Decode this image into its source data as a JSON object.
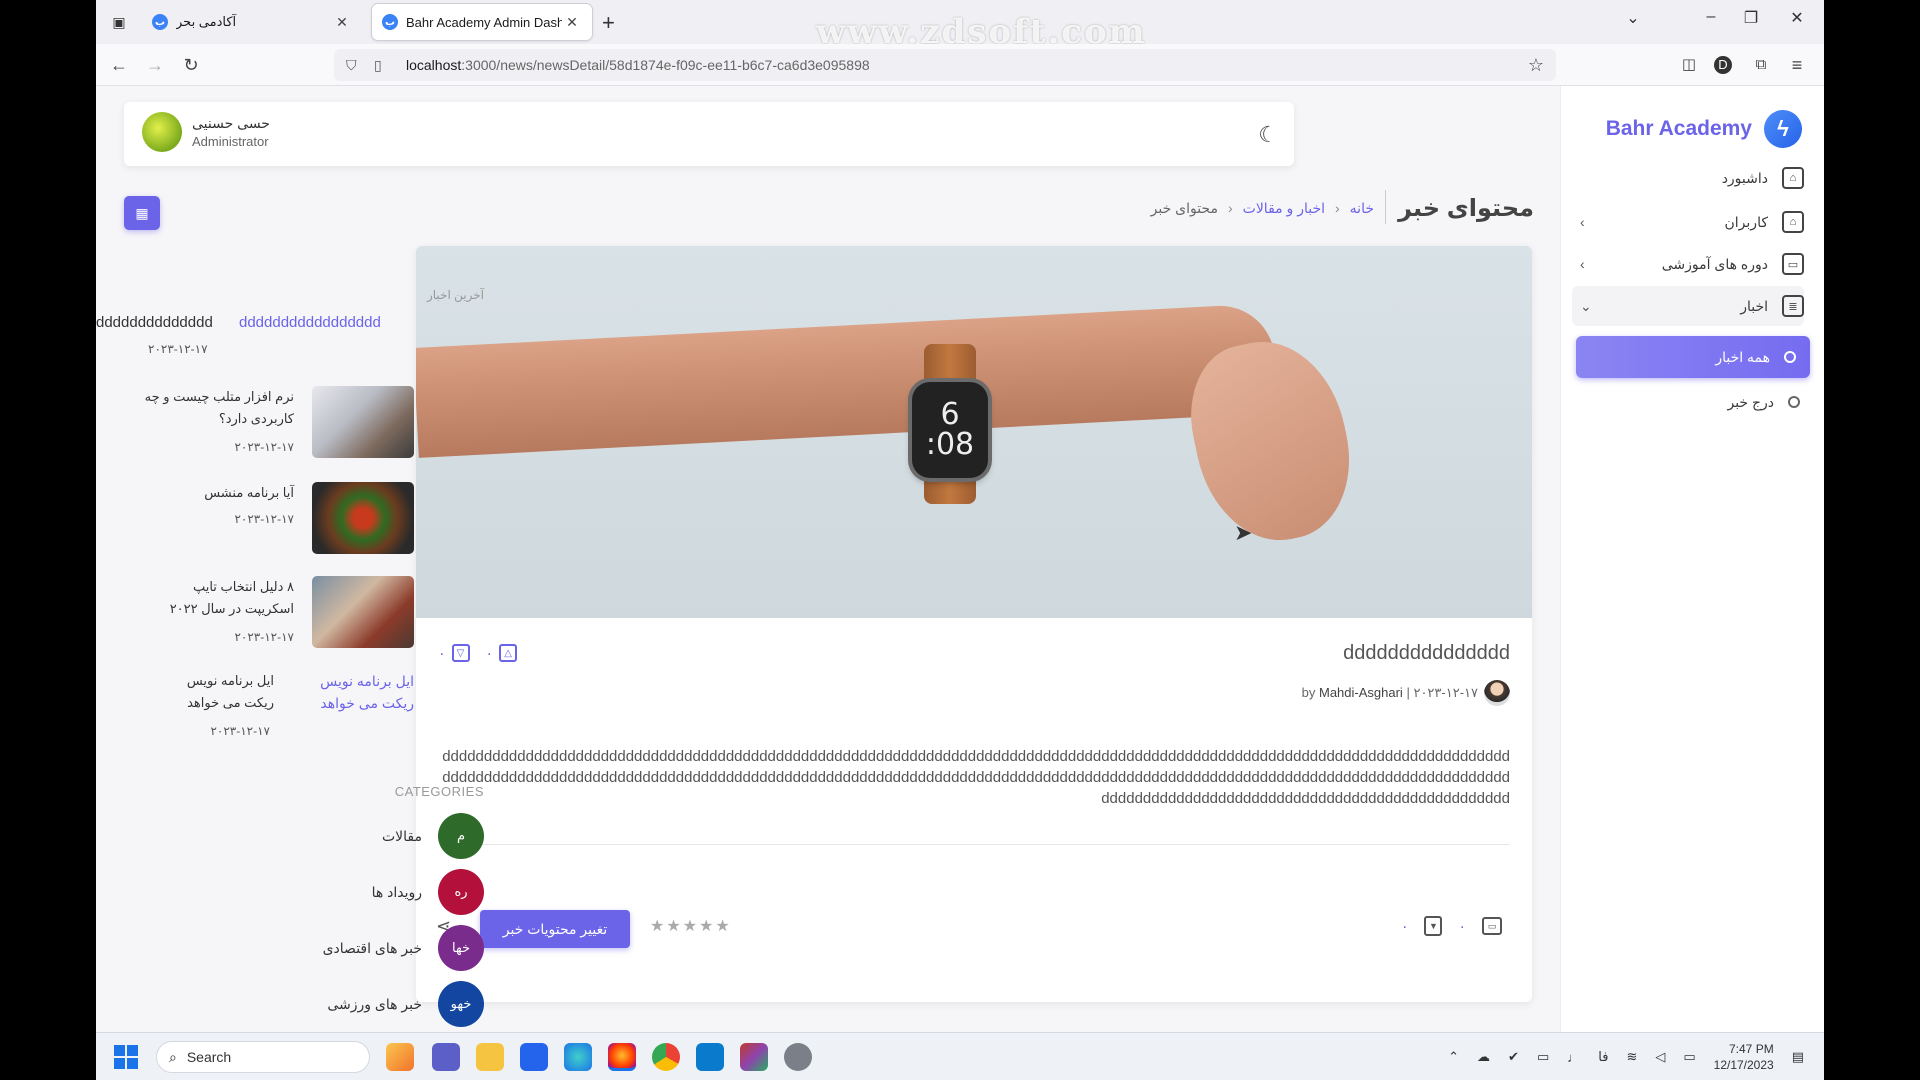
{
  "browser": {
    "tabs": [
      {
        "label": "آکادمی بحر",
        "active": false
      },
      {
        "label": "Bahr Academy Admin Dashboa",
        "active": true
      }
    ],
    "url_host": "localhost",
    "url_path": ":3000/news/newsDetail/58d1874e-f09c-ee11-b6c7-ca6d3e095898",
    "watermark": "www.zdsoft.com"
  },
  "sidebar": {
    "brand": "Bahr Academy",
    "items": [
      {
        "label": "داشبورد",
        "icon": "home-icon"
      },
      {
        "label": "کاربران",
        "icon": "home-icon"
      },
      {
        "label": "دوره های آموزشی",
        "icon": "monitor-icon"
      },
      {
        "label": "اخبار",
        "icon": "document-icon"
      },
      {
        "label": "همه اخبار",
        "icon": "circle-icon"
      },
      {
        "label": "درج خبر",
        "icon": "circle-icon"
      }
    ]
  },
  "header": {
    "user_name": "حسی حسنیی",
    "user_role": "Administrator"
  },
  "breadcrumb": {
    "title": "محتوای خبر",
    "home": "خانه",
    "section": "اخبار و مقالات",
    "current": "محتوای خبر"
  },
  "article": {
    "title": "ddddddddddddddd",
    "likes": "۰",
    "dislikes": "۰",
    "by_prefix": "by",
    "author": "Mahdi-Asghari",
    "meta_sep": "|",
    "date": "۲۰۲۳-۱۲-۱۷",
    "body": "ddddddddddddddddddddddddddddddddddddddddddddddddddddddddddddddddddddddddddddddddddddddddddddddddddddddddddddddddddddddddddddddddddddddddddddddddddddddddddddddddddddddddddddddddddddddddddddddddddddddddddddddddddddddddddddddddddddddddddddddddddddddddddddddddddddddddddddddddddddddddddddddddddddddddddddddddd",
    "watch_hour": "6",
    "watch_min": ":08",
    "edit_button": "تغییر محتویات خبر",
    "stars": "★★★★★",
    "bookmarks": "۰",
    "comments": "۰"
  },
  "latest": {
    "heading": "آخرین اخبار",
    "first_dark": "dddddddddddddd",
    "first_link": "ddddddddddddddddd",
    "first_date": "۲۰۲۳-۱۲-۱۷",
    "items": [
      {
        "title": "نرم افزار متلب چیست و چه کاربردی دارد؟",
        "date": "۲۰۲۳-۱۲-۱۷"
      },
      {
        "title": "آیا برنامه منشس",
        "date": "۲۰۲۳-۱۲-۱۷"
      },
      {
        "title": "۸ دلیل انتخاب تایپ اسکریپت در سال ۲۰۲۲",
        "date": "۲۰۲۳-۱۲-۱۷"
      },
      {
        "title": "ایل برنامه نویس ریکت می خواهد",
        "date": "۲۰۲۳-۱۲-۱۷"
      }
    ],
    "last_link": "ایل برنامه نویس ریکت می خواهد"
  },
  "categories": {
    "heading": "CATEGORIES",
    "items": [
      {
        "name": "مقالات",
        "badge": "م",
        "color": "#2e6b2a"
      },
      {
        "name": "رویداد ها",
        "badge": "ره",
        "color": "#b3103c"
      },
      {
        "name": "خبر های اقتصادی",
        "badge": "خها",
        "color": "#7a2c8c"
      },
      {
        "name": "خبر های ورزشی",
        "badge": "خهو",
        "color": "#1346a0"
      }
    ]
  },
  "taskbar": {
    "search_placeholder": "Search",
    "time": "7:47 PM",
    "date": "12/17/2023",
    "lang": "فا"
  }
}
